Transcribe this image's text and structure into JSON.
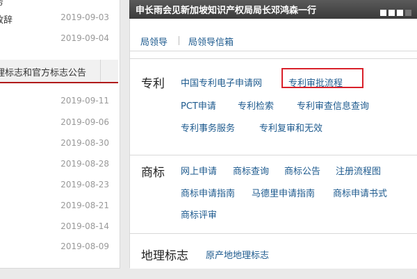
{
  "left_panel": {
    "top_items": [
      {
        "text": "务",
        "date": ""
      },
      {
        "text": "致辞",
        "date": "2019-09-03"
      },
      {
        "text": "",
        "date": "2019-09-04"
      }
    ],
    "header": "理标志和官方标志公告",
    "dates": [
      "2019-09-11",
      "2019-09-06",
      "2019-08-30",
      "2019-08-28",
      "2019-08-23",
      "2019-08-21",
      "2019-08-14",
      "2019-08-09"
    ]
  },
  "banner": {
    "caption": "申长雨会见新加坡知识产权局局长邓鸿森一行"
  },
  "leaders": {
    "link1": "局领导",
    "link2": "局领导信箱"
  },
  "patent": {
    "title": "专利",
    "links": [
      "中国专利电子申请网",
      "专利审批流程",
      "PCT申请",
      "专利检索",
      "专利审查信息查询",
      "专利事务服务",
      "专利复审和无效"
    ]
  },
  "trademark": {
    "title": "商标",
    "links": [
      "网上申请",
      "商标查询",
      "商标公告",
      "注册流程图",
      "商标申请指南",
      "马德里申请指南",
      "商标申请书式",
      "商标评审"
    ]
  },
  "geo": {
    "title": "地理标志",
    "links": [
      "原产地地理标志"
    ]
  },
  "colors": {
    "link": "#1d5a8e",
    "accent": "#b01a1a",
    "highlight": "#d9202a"
  }
}
